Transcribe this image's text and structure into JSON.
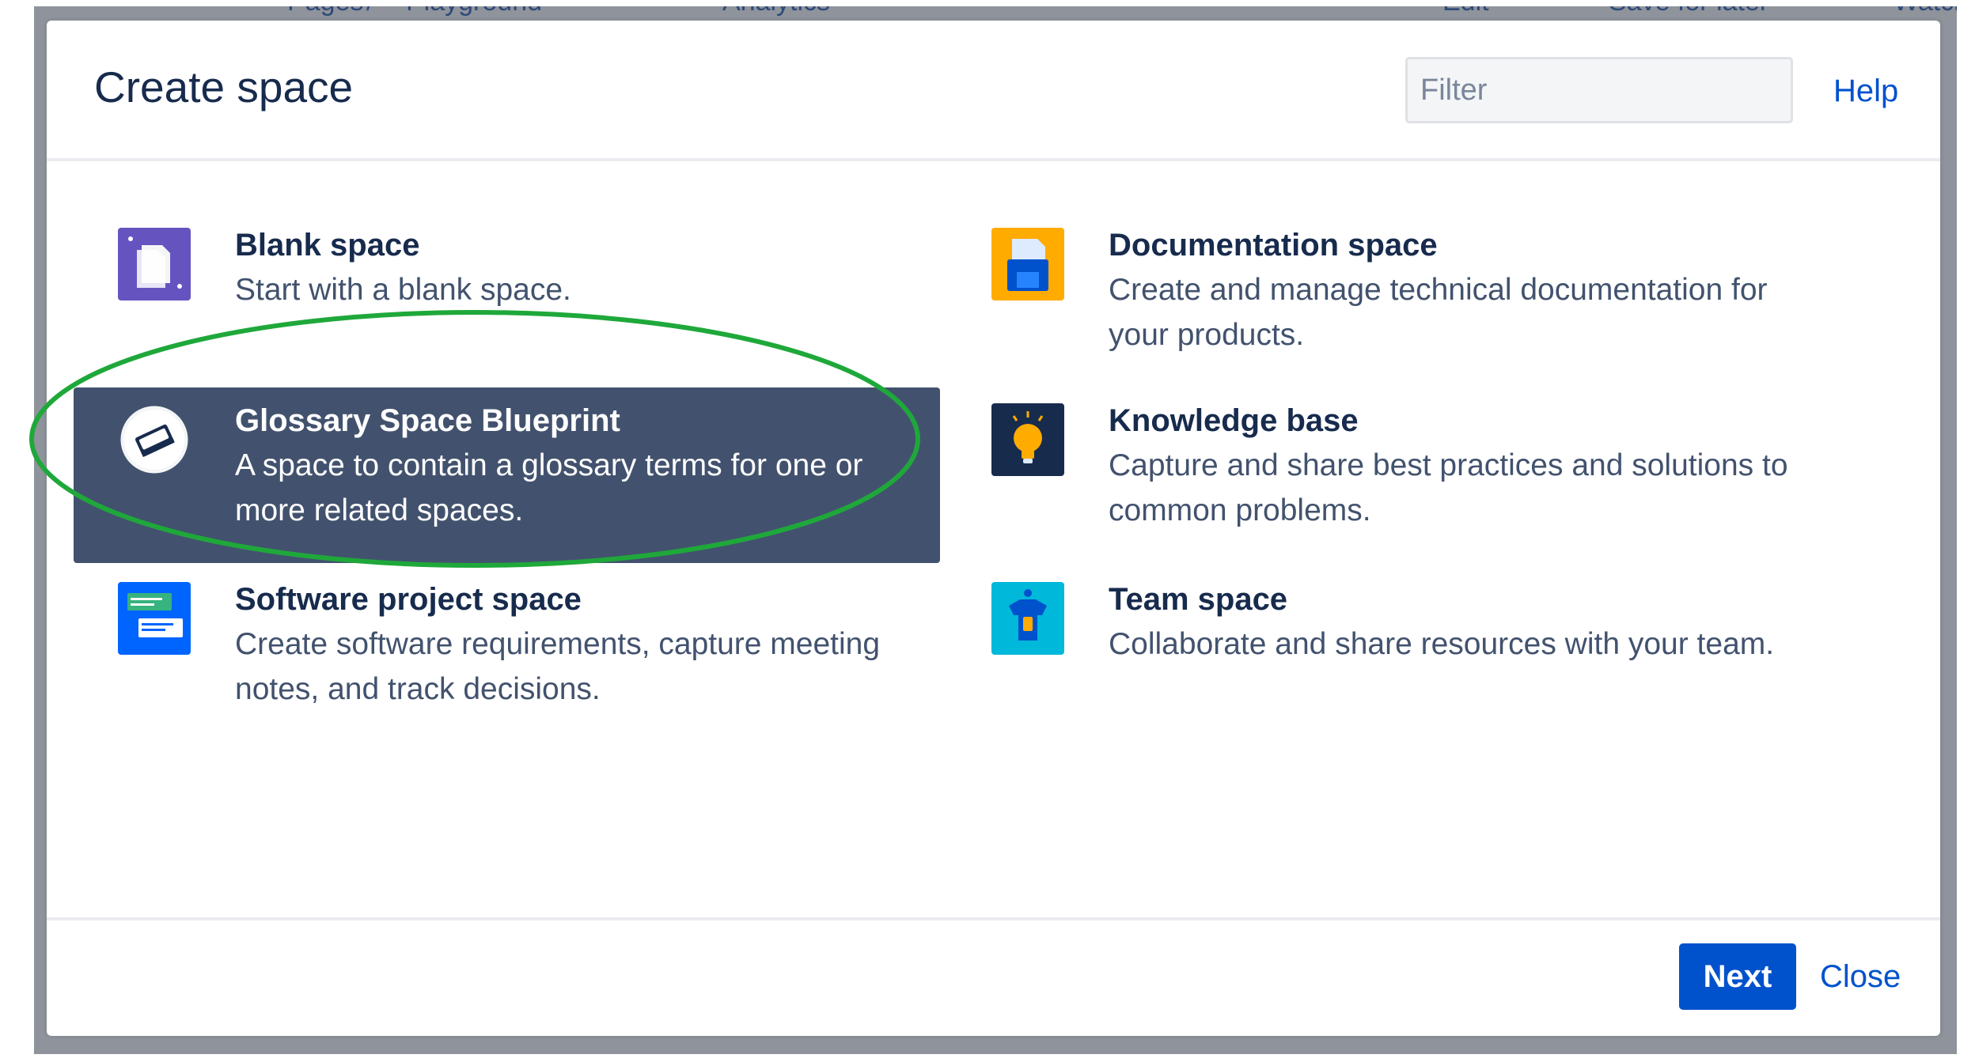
{
  "background": {
    "breadcrumb_pages": "Pages",
    "breadcrumb_separator": "/",
    "breadcrumb_space": "Playground",
    "analytics": "Analytics",
    "edit": "Edit",
    "save_for_later": "Save for later",
    "watch": "Watch"
  },
  "dialog": {
    "title": "Create space",
    "filter_placeholder": "Filter",
    "help_label": "Help",
    "next_label": "Next",
    "close_label": "Close"
  },
  "blueprints": [
    {
      "name": "Blank space",
      "description": "Start with a blank space.",
      "icon": "blank-space-icon",
      "selected": false
    },
    {
      "name": "Documentation space",
      "description": "Create and manage technical documentation for your products.",
      "icon": "documentation-space-icon",
      "selected": false
    },
    {
      "name": "Glossary Space Blueprint",
      "description": "A space to contain a glossary terms for one or more related spaces.",
      "icon": "glossary-book-icon",
      "selected": true
    },
    {
      "name": "Knowledge base",
      "description": "Capture and share best practices and solutions to common problems.",
      "icon": "knowledge-base-lightbulb-icon",
      "selected": false
    },
    {
      "name": "Software project space",
      "description": "Create software requirements, capture meeting notes, and track decisions.",
      "icon": "software-project-icon",
      "selected": false
    },
    {
      "name": "Team space",
      "description": "Collaborate and share resources with your team.",
      "icon": "team-space-icon",
      "selected": false
    }
  ],
  "colors": {
    "selected_bg": "#42526e",
    "primary": "#0052cc",
    "annotation": "#1fa83a"
  }
}
